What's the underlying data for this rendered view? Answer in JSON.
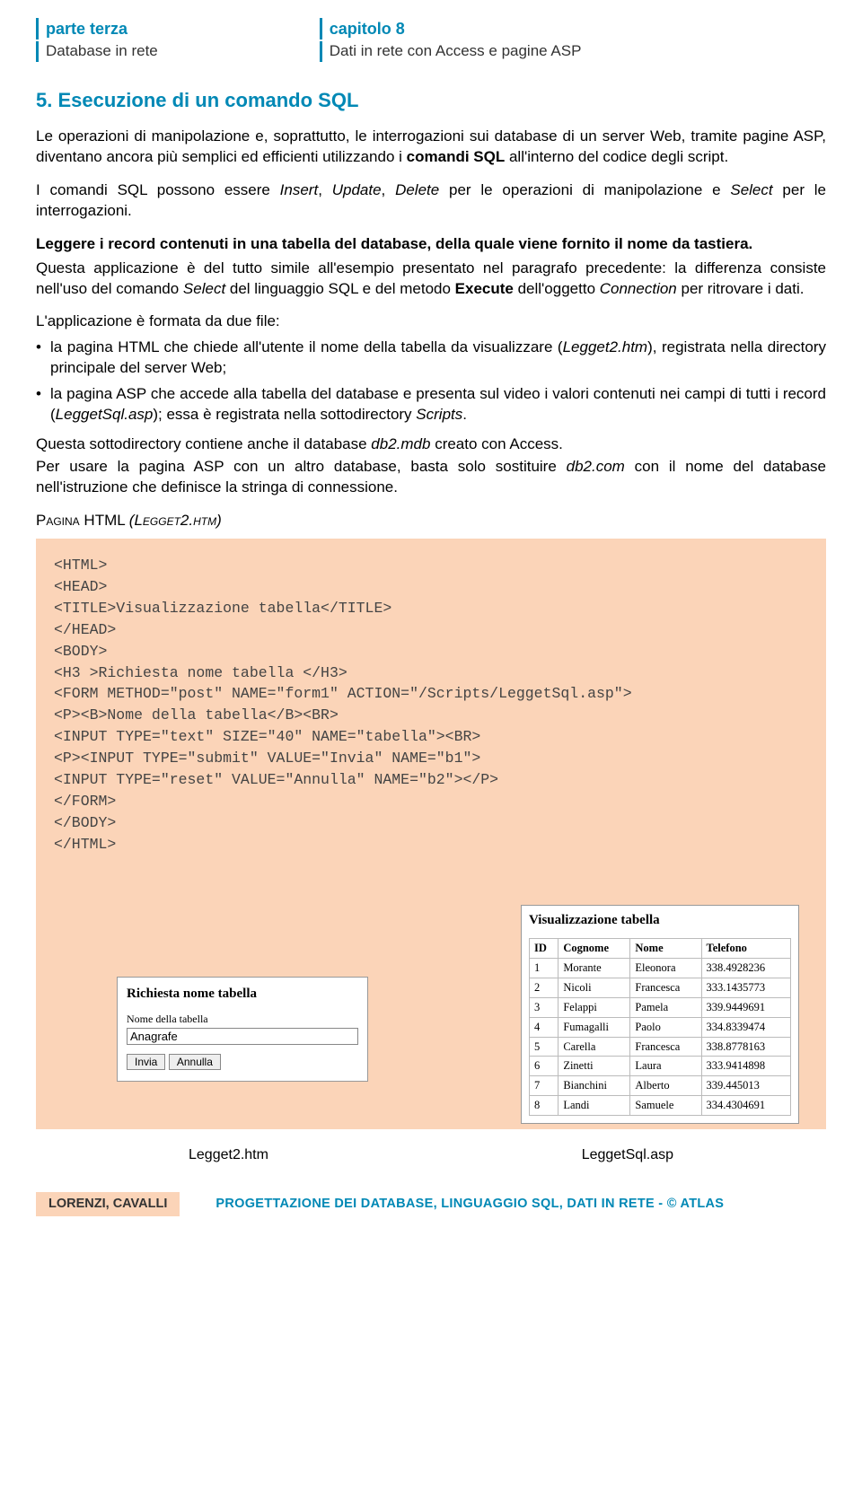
{
  "header": {
    "part_label": "parte terza",
    "part_sub": "Database in rete",
    "chapter_label": "capitolo 8",
    "chapter_sub": "Dati in rete con Access e pagine ASP"
  },
  "section": {
    "title": "5. Esecuzione di un comando SQL",
    "p1a": "Le operazioni di manipolazione e, soprattutto, le interrogazioni sui database di un server Web, tramite pagine ASP, diventano ancora più semplici ed efficienti utilizzando i ",
    "p1b": "comandi SQL",
    "p1c": " all'interno del codice degli script.",
    "p2a": "I comandi SQL possono essere ",
    "p2b": "Insert",
    "p2c": ", ",
    "p2d": "Update",
    "p2e": ", ",
    "p2f": "Delete",
    "p2g": " per le operazioni di manipolazione e ",
    "p2h": "Select",
    "p2i": " per le interrogazioni.",
    "sub1": "Leggere i record contenuti in una tabella del database, della quale viene fornito il nome da tastiera.",
    "p3a": "Questa applicazione è del tutto simile all'esempio presentato nel paragrafo precedente: la differenza consiste nell'uso del comando ",
    "p3b": "Select",
    "p3c": " del linguaggio SQL e del metodo ",
    "p3d": "Execute",
    "p3e": " dell'oggetto ",
    "p3f": "Connection",
    "p3g": " per ritrovare i dati.",
    "p4": "L'applicazione è formata da due file:",
    "li1a": "la pagina HTML che chiede all'utente il nome della tabella da visualizzare (",
    "li1b": "Legget2.htm",
    "li1c": "), registrata nella directory principale del server Web;",
    "li2a": "la pagina ASP che accede alla tabella del database e presenta sul video i valori contenuti nei campi di tutti i record (",
    "li2b": "LeggetSql.asp",
    "li2c": "); essa è registrata nella sottodirectory ",
    "li2d": "Scripts",
    "li2e": ".",
    "p5a": "Questa sottodirectory contiene anche il database ",
    "p5b": "db2.mdb",
    "p5c": " creato con Access.",
    "p6a": "Per usare la pagina ASP con un altro database, basta solo sostituire ",
    "p6b": "db2.com",
    "p6c": " con il nome del database nell'istruzione che definisce la stringa di connessione.",
    "pagina_label_a": "Pagina",
    "pagina_label_b": " HTML ",
    "pagina_label_c": "(Legget2.htm)"
  },
  "code": "<HTML>\n<HEAD>\n<TITLE>Visualizzazione tabella</TITLE>\n</HEAD>\n<BODY>\n<H3 >Richiesta nome tabella </H3>\n<FORM METHOD=\"post\" NAME=\"form1\" ACTION=\"/Scripts/LeggetSql.asp\">\n<P><B>Nome della tabella</B><BR>\n<INPUT TYPE=\"text\" SIZE=\"40\" NAME=\"tabella\"><BR>\n<P><INPUT TYPE=\"submit\" VALUE=\"Invia\" NAME=\"b1\">\n<INPUT TYPE=\"reset\" VALUE=\"Annulla\" NAME=\"b2\"></P>\n</FORM>\n</BODY>\n</HTML>\n\n\n\n\n\n\n\n\n\n\n\n\n",
  "form_shot": {
    "title": "Richiesta nome tabella",
    "label": "Nome della tabella",
    "input_value": "Anagrafe",
    "btn_submit": "Invia",
    "btn_reset": "Annulla"
  },
  "table_shot": {
    "title": "Visualizzazione tabella",
    "headers": [
      "ID",
      "Cognome",
      "Nome",
      "Telefono"
    ],
    "rows": [
      [
        "1",
        "Morante",
        "Eleonora",
        "338.4928236"
      ],
      [
        "2",
        "Nicoli",
        "Francesca",
        "333.1435773"
      ],
      [
        "3",
        "Felappi",
        "Pamela",
        "339.9449691"
      ],
      [
        "4",
        "Fumagalli",
        "Paolo",
        "334.8339474"
      ],
      [
        "5",
        "Carella",
        "Francesca",
        "338.8778163"
      ],
      [
        "6",
        "Zinetti",
        "Laura",
        "333.9414898"
      ],
      [
        "7",
        "Bianchini",
        "Alberto",
        "339.445013"
      ],
      [
        "8",
        "Landi",
        "Samuele",
        "334.4304691"
      ]
    ]
  },
  "captions": {
    "left": "Legget2.htm",
    "right": "LeggetSql.asp"
  },
  "footer": {
    "author": "LORENZI, CAVALLI",
    "title": "PROGETTAZIONE DEI DATABASE, LINGUAGGIO SQL, DATI IN RETE - © ATLAS"
  }
}
